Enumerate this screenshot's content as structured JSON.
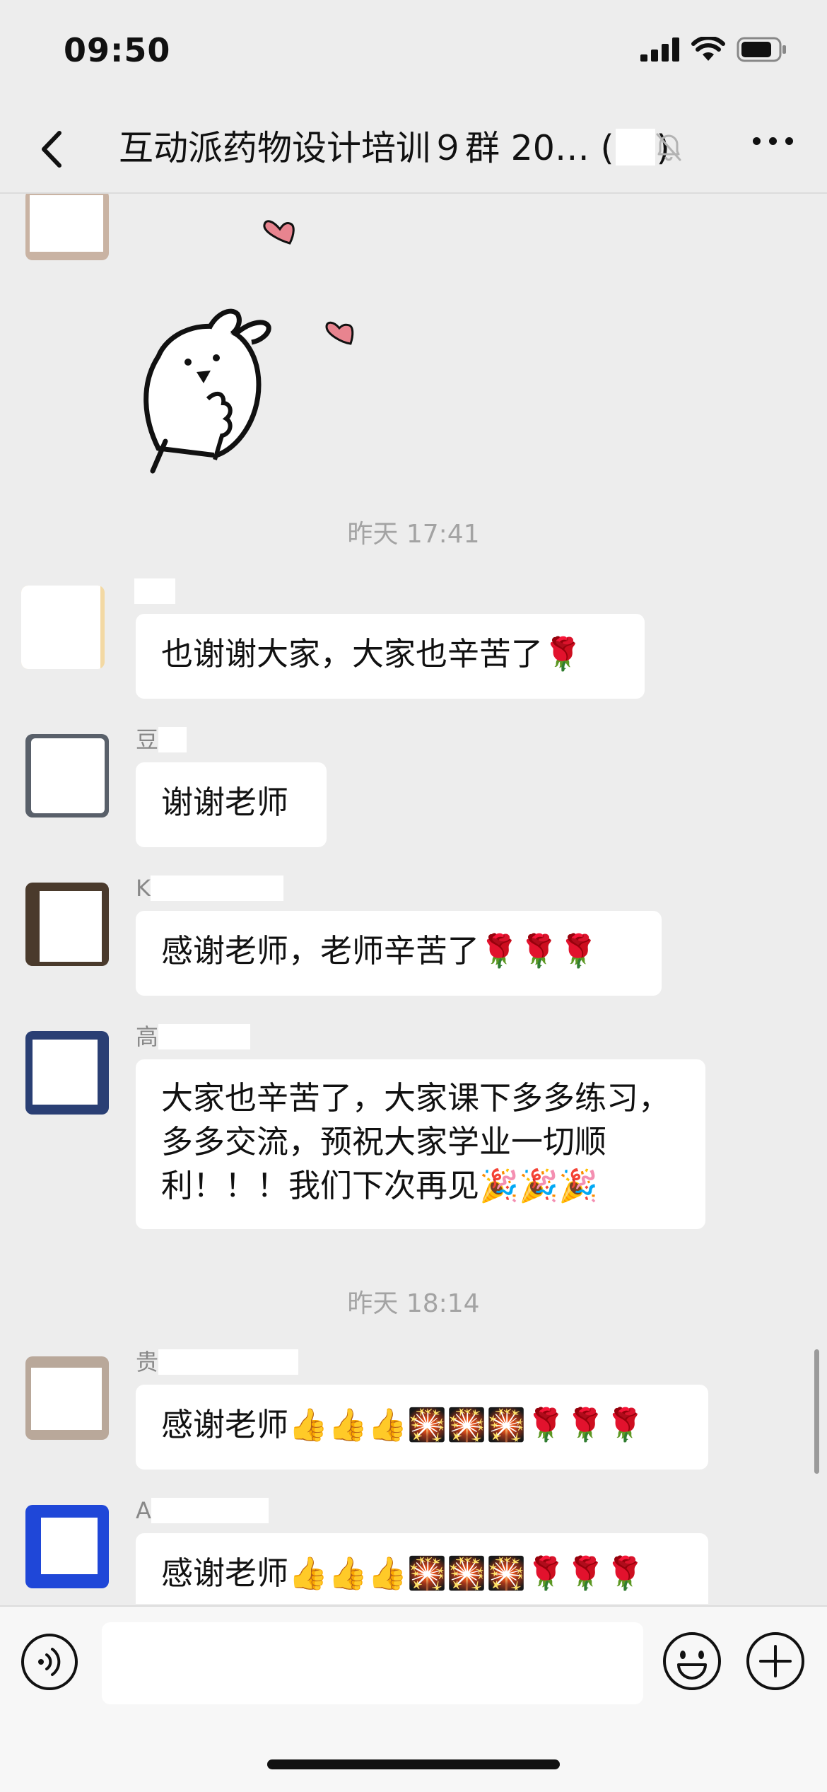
{
  "status_bar": {
    "time": "09:50"
  },
  "nav": {
    "title_text": "互动派药物设计培训９群 20… (",
    "title_close": ")"
  },
  "messages": {
    "timestamp_1": "昨天 17:41",
    "timestamp_2": "昨天 18:14",
    "msg1": {
      "sender_prefix": "",
      "text": "也谢谢大家，大家也辛苦了🌹"
    },
    "msg2": {
      "sender_prefix": "豆",
      "text": "谢谢老师"
    },
    "msg3": {
      "sender_prefix": "K",
      "text": "感谢老师，老师辛苦了🌹🌹🌹"
    },
    "msg4": {
      "sender_prefix": "高",
      "text": "大家也辛苦了，大家课下多多练习，多多交流，预祝大家学业一切顺利！！！我们下次再见🎉🎉🎉"
    },
    "msg5": {
      "sender_prefix": "贵",
      "text": "感谢老师👍👍👍🎇🎇🎇🌹🌹🌹"
    },
    "msg6": {
      "sender_prefix": "A",
      "text": "感谢老师👍👍👍🎇🎇🎇🌹🌹🌹"
    }
  },
  "icons": {
    "back": "chevron-left-icon",
    "mute": "bell-slash-icon",
    "more": "ellipsis-icon",
    "voice": "voice-icon",
    "emoji": "emoji-icon",
    "plus": "plus-icon"
  }
}
